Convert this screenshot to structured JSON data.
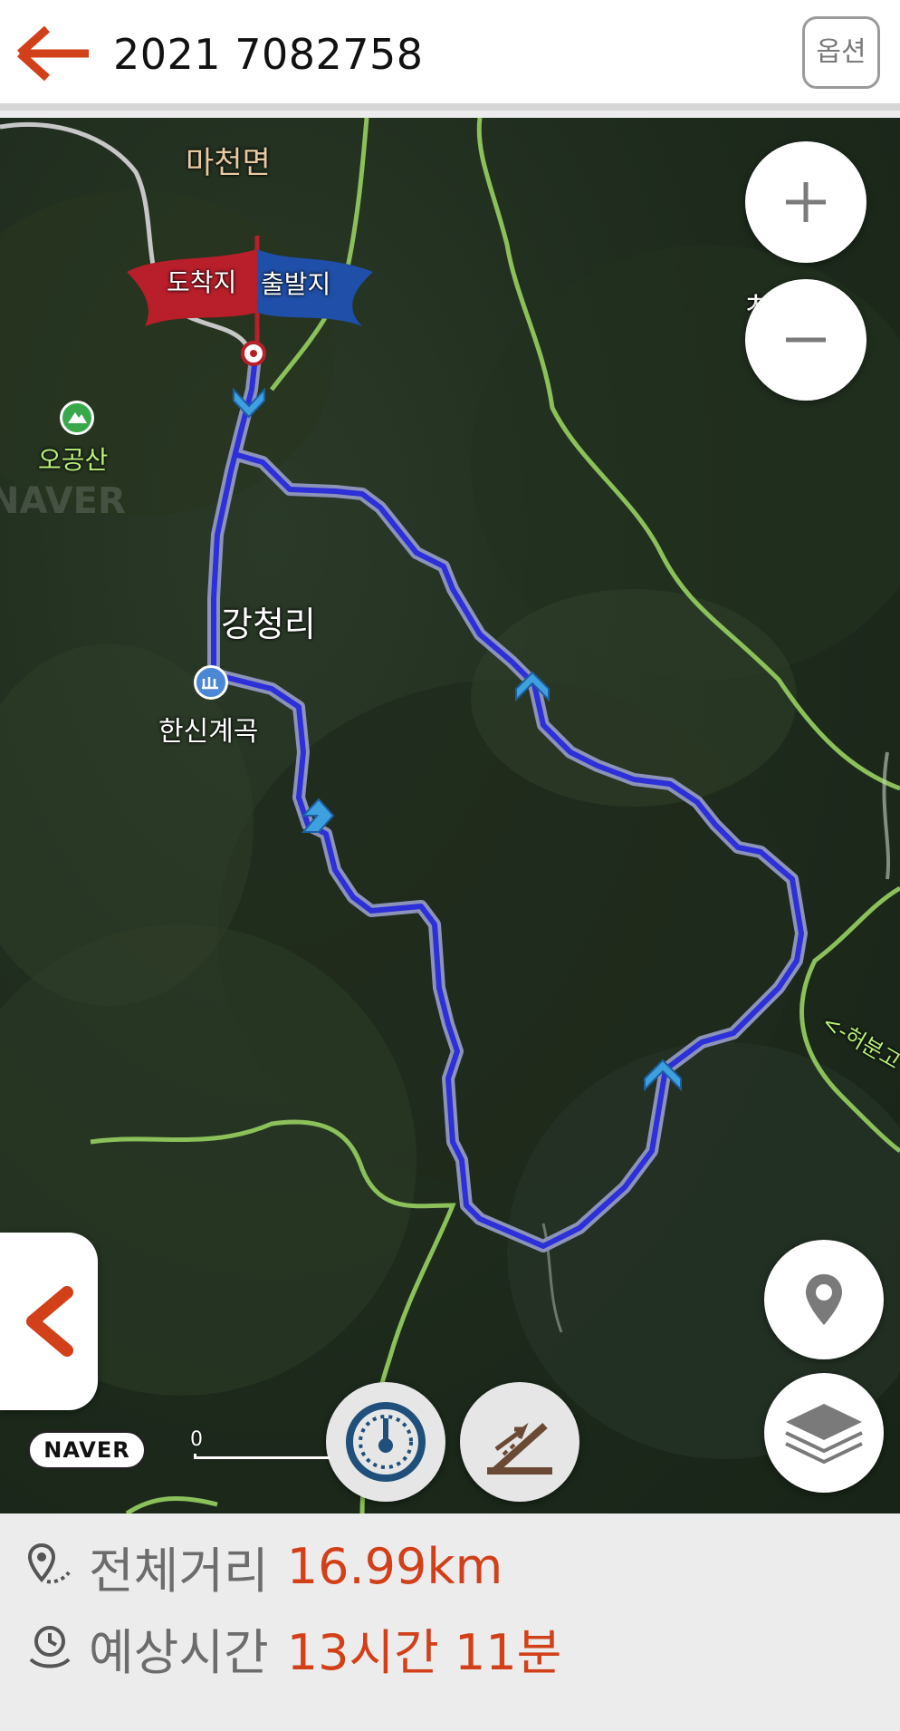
{
  "header": {
    "title": "2021 7082758",
    "option_label": "옵션",
    "back_icon": "arrow-left-icon"
  },
  "map": {
    "labels": {
      "macheon": "마천면",
      "ogongsan": "오공산",
      "gangcheongri": "강청리",
      "hansin": "한신계곡",
      "partial_right": "ㅊ",
      "trail_partial": "<-허분고"
    },
    "flags": {
      "arrival": "도착지",
      "departure": "출발지"
    },
    "watermark": "NAVER",
    "scale_zero": "0",
    "route_color": "#2d2fd8",
    "flag_red": "#b91f2a",
    "flag_blue": "#1f4fa8",
    "accent": "#d2401a"
  },
  "controls": {
    "zoom_in": "plus-icon",
    "zoom_out": "minus-icon",
    "location": "location-pin-icon",
    "layers": "layers-icon",
    "speedometer": "speedometer-icon",
    "elevation": "elevation-icon",
    "side_tab": "chevron-left-icon"
  },
  "summary": {
    "distance_label": "전체거리",
    "distance_value": "16.99km",
    "time_label": "예상시간",
    "time_value": "13시간 11분"
  }
}
